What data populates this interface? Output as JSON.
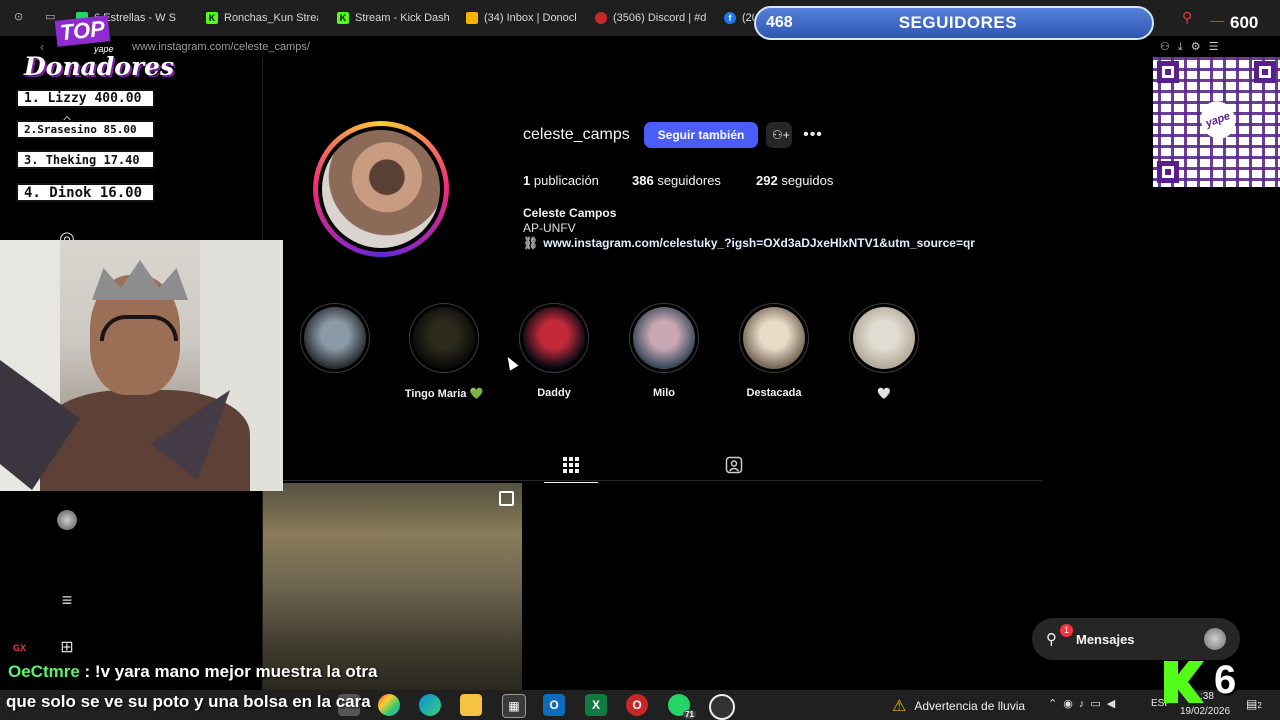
{
  "browser": {
    "tabs": [
      {
        "label": "6 Estrellas - W S",
        "icon": "whatsapp-icon",
        "color": "#25d366"
      },
      {
        "label": "Ronchas_Kun Strea",
        "icon": "kick-icon",
        "color": "#53fc18"
      },
      {
        "label": "Stream - Kick Dashb",
        "icon": "kick-icon",
        "color": "#53fc18"
      },
      {
        "label": "(34) Inbox | Donocl",
        "icon": "inbox-icon",
        "color": "#f2b400"
      },
      {
        "label": "(3506) Discord | #d",
        "icon": "discord-icon",
        "color": "#5865f2"
      },
      {
        "label": "(20",
        "icon": "facebook-icon",
        "color": "#1877f2"
      }
    ],
    "url": "www.instagram.com/celeste_camps/"
  },
  "profile": {
    "username": "celeste_camps",
    "follow_label": "Seguir también",
    "stats": [
      {
        "value": "1",
        "label": "publicación"
      },
      {
        "value": "386",
        "label": "seguidores"
      },
      {
        "value": "292",
        "label": "seguidos"
      }
    ],
    "bio_name": "Celeste Campos",
    "bio_line": "AP-UNFV",
    "link": "www.instagram.com/celestuky_?igsh=OXd3aDJxeHlxNTV1&utm_source=qr"
  },
  "highlights": [
    {
      "label": "",
      "colors": [
        "#2a2e33",
        "#8a9aa6"
      ]
    },
    {
      "label": "Tingo Maria 💚",
      "colors": [
        "#0b0c0a",
        "#2c2a1c"
      ]
    },
    {
      "label": "Daddy",
      "colors": [
        "#0a0a14",
        "#c22a3a"
      ]
    },
    {
      "label": "Milo",
      "colors": [
        "#3a4a5a",
        "#c9a7b3"
      ]
    },
    {
      "label": "Destacada",
      "colors": [
        "#7a6a5a",
        "#e8dcc8"
      ]
    },
    {
      "label": "🤍",
      "colors": [
        "#b3aa9a",
        "#e2ddd3"
      ]
    }
  ],
  "messages": {
    "label": "Mensajes",
    "badge": "1"
  },
  "overlay": {
    "top_title_1": "TOP",
    "top_title_small": "yape",
    "top_title_2": "Donadores",
    "donors": [
      {
        "rank": "1.",
        "text": "Lizzy 400.00"
      },
      {
        "rank": "2.",
        "text": "Srasesino 85.00"
      },
      {
        "rank": "3.",
        "text": "Theking 17.40"
      },
      {
        "rank": "4.",
        "text": "Dinok 16.00"
      }
    ],
    "followers_current": "468",
    "followers_label": "SEGUIDORES",
    "followers_goal": "600",
    "kick_viewers": "6",
    "kick_small": "GX",
    "qr_logo": "yape"
  },
  "chat": {
    "user": "OeCtmre",
    "message": ": !v yara mano mejor muestra la otra",
    "message2": "que solo se ve su poto y una bolsa en la cara"
  },
  "taskbar": {
    "weather": "Advertencia de lluvia",
    "lang": "ESP",
    "time": ":38",
    "date": "19/02/2026",
    "whatsapp_badge": "71",
    "notif_badge": "2"
  }
}
